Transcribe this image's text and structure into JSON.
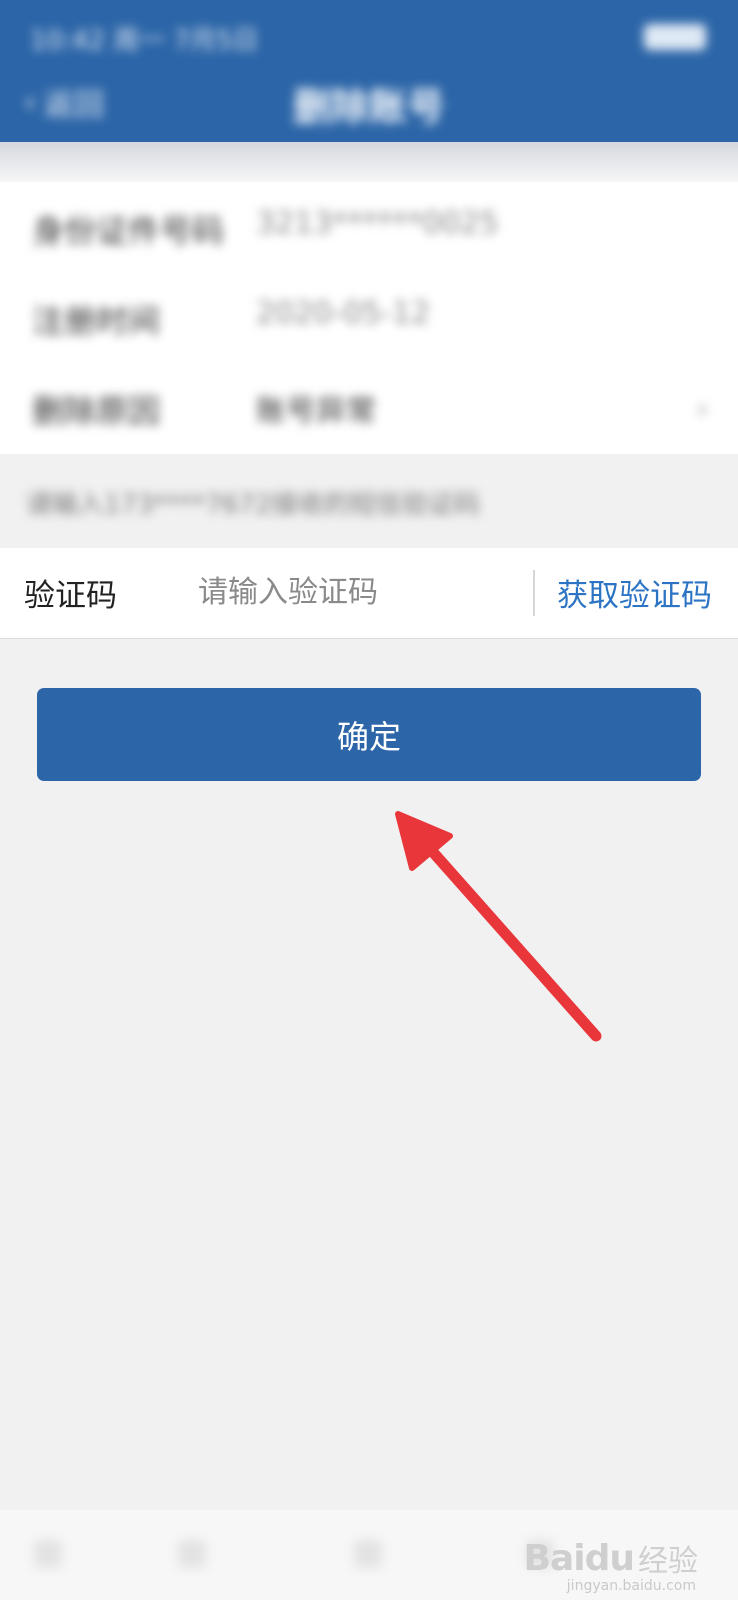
{
  "status_bar": {
    "time": "10:42 周一 7月5日",
    "battery": "电池"
  },
  "nav": {
    "back_label": "返回",
    "title": "删除账号"
  },
  "info_rows": [
    {
      "label": "身份证件号码",
      "value": "3213******0025"
    },
    {
      "label": "注册时间",
      "value": "2020-05-12"
    },
    {
      "label": "删除原因",
      "value": "账号异常"
    }
  ],
  "hint": "请输入173****7672接收的短信验证码",
  "verify": {
    "label": "验证码",
    "placeholder": "请输入验证码",
    "get_code_label": "获取验证码"
  },
  "confirm": {
    "label": "确定"
  },
  "watermark": {
    "logo": "Baidu",
    "text": "经验",
    "url": "jingyan.baidu.com"
  },
  "colors": {
    "primary": "#2d66a8",
    "link": "#2e74c4",
    "arrow": "#e8363a",
    "background": "#f1f1f2"
  },
  "icons": [
    "chevron-left-icon",
    "chevron-right-icon",
    "battery-icon",
    "red-arrow-annotation"
  ]
}
